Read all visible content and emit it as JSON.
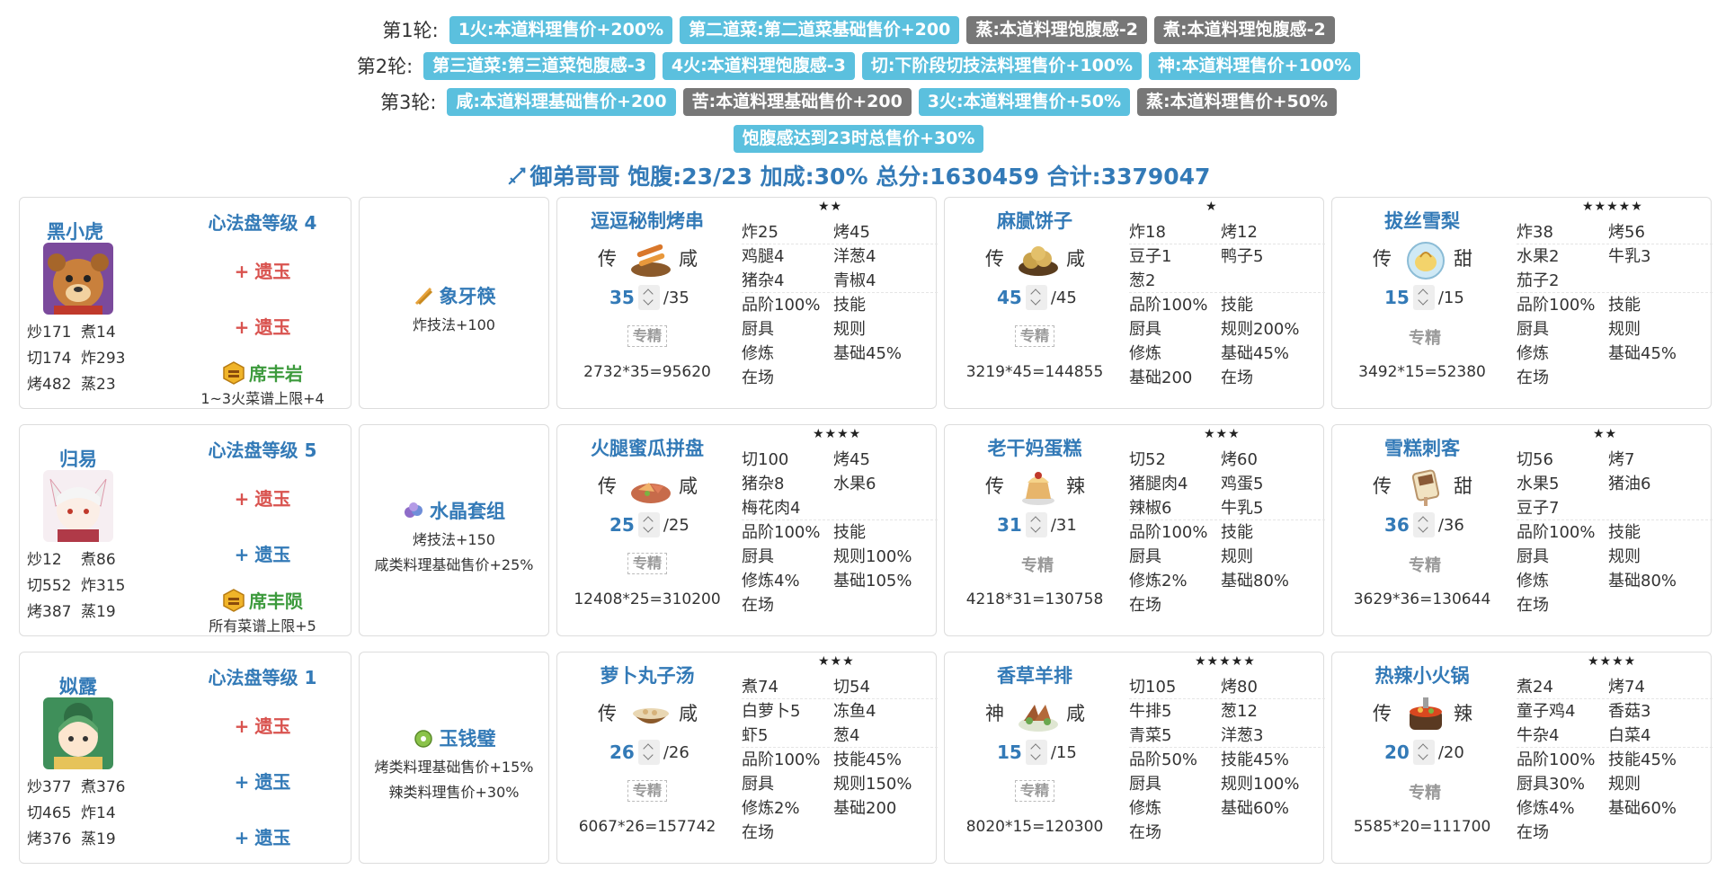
{
  "rounds": [
    {
      "label": "第1轮:",
      "tags": [
        {
          "text": "1火:本道料理售价+200%",
          "color": "blue"
        },
        {
          "text": "第二道菜:第二道菜基础售价+200",
          "color": "blue"
        },
        {
          "text": "蒸:本道料理饱腹感-2",
          "color": "gray"
        },
        {
          "text": "煮:本道料理饱腹感-2",
          "color": "gray"
        }
      ]
    },
    {
      "label": "第2轮:",
      "tags": [
        {
          "text": "第三道菜:第三道菜饱腹感-3",
          "color": "blue"
        },
        {
          "text": "4火:本道料理饱腹感-3",
          "color": "blue"
        },
        {
          "text": "切:下阶段切技法料理售价+100%",
          "color": "blue"
        },
        {
          "text": "神:本道料理售价+100%",
          "color": "blue"
        }
      ]
    },
    {
      "label": "第3轮:",
      "tags": [
        {
          "text": "咸:本道料理基础售价+200",
          "color": "blue"
        },
        {
          "text": "苦:本道料理基础售价+200",
          "color": "gray"
        },
        {
          "text": "3火:本道料理售价+50%",
          "color": "blue"
        },
        {
          "text": "蒸:本道料理售价+50%",
          "color": "gray"
        }
      ]
    },
    {
      "label": "",
      "tags": [
        {
          "text": "饱腹感达到23时总售价+30%",
          "color": "blue"
        }
      ]
    }
  ],
  "summary": {
    "text": "御弟哥哥 饱腹:23/23 加成:30% 总分:1630459 合计:3379047",
    "icon": "sword-icon"
  },
  "rows": [
    {
      "chef": {
        "name": "黑小虎",
        "avatar": "bear-avatar",
        "stats": [
          [
            "炒171",
            "煮14"
          ],
          [
            "切174",
            "炸293"
          ],
          [
            "烤482",
            "蒸23"
          ]
        ],
        "level": "心法盘等级 4",
        "ambers": [
          {
            "plus": "+",
            "name": "遗玉",
            "color": "red",
            "icon": ""
          },
          {
            "plus": "+",
            "name": "遗玉",
            "color": "red",
            "icon": ""
          },
          {
            "plus": "",
            "name": "席丰岩",
            "color": "green",
            "icon": "amber-icon"
          }
        ],
        "amber_desc": "1~3火菜谱上限+4"
      },
      "equip": {
        "name": "象牙筷",
        "icon": "chopsticks-icon",
        "effects": [
          "炸技法+100"
        ]
      },
      "recipes": [
        {
          "name": "逗逗秘制烤串",
          "origin": "传",
          "taste": "咸",
          "qty": "35",
          "max": "/35",
          "spec": "专精",
          "spec_struck": true,
          "score": "2732*35=95620",
          "stars": "★★",
          "details": [
            [
              "炸25",
              "烤45"
            ],
            [
              "鸡腿4",
              "洋葱4"
            ],
            [
              "猪杂4",
              "青椒4"
            ],
            [
              "品阶100%",
              "技能"
            ],
            [
              "厨具",
              "规则"
            ],
            [
              "修炼",
              "基础45%"
            ],
            [
              "在场",
              ""
            ]
          ]
        },
        {
          "name": "麻腻饼子",
          "origin": "传",
          "taste": "咸",
          "qty": "45",
          "max": "/45",
          "spec": "专精",
          "spec_struck": true,
          "score": "3219*45=144855",
          "stars": "★",
          "details": [
            [
              "炸18",
              "烤12"
            ],
            [
              "豆子1",
              "鸭子5"
            ],
            [
              "葱2",
              ""
            ],
            [
              "品阶100%",
              "技能"
            ],
            [
              "厨具",
              "规则200%"
            ],
            [
              "修炼",
              "基础45%"
            ],
            [
              "基础200",
              "在场"
            ]
          ]
        },
        {
          "name": "拔丝雪梨",
          "origin": "传",
          "taste": "甜",
          "qty": "15",
          "max": "/15",
          "spec": "专精",
          "spec_struck": false,
          "score": "3492*15=52380",
          "stars": "★★★★★",
          "details": [
            [
              "炸38",
              "烤56"
            ],
            [
              "水果2",
              "牛乳3"
            ],
            [
              "茄子2",
              ""
            ],
            [
              "品阶100%",
              "技能"
            ],
            [
              "厨具",
              "规则"
            ],
            [
              "修炼",
              "基础45%"
            ],
            [
              "在场",
              ""
            ]
          ]
        }
      ]
    },
    {
      "chef": {
        "name": "归易",
        "avatar": "fox-avatar",
        "stats": [
          [
            "炒12",
            "煮86"
          ],
          [
            "切552",
            "炸315"
          ],
          [
            "烤387",
            "蒸19"
          ]
        ],
        "level": "心法盘等级 5",
        "ambers": [
          {
            "plus": "+",
            "name": "遗玉",
            "color": "red",
            "icon": ""
          },
          {
            "plus": "+",
            "name": "遗玉",
            "color": "blue",
            "icon": ""
          },
          {
            "plus": "",
            "name": "席丰陨",
            "color": "green",
            "icon": "amber-icon"
          }
        ],
        "amber_desc": "所有菜谱上限+5"
      },
      "equip": {
        "name": "水晶套组",
        "icon": "crystal-icon",
        "effects": [
          "烤技法+150",
          "咸类料理基础售价+25%"
        ]
      },
      "recipes": [
        {
          "name": "火腿蜜瓜拼盘",
          "origin": "传",
          "taste": "咸",
          "qty": "25",
          "max": "/25",
          "spec": "专精",
          "spec_struck": true,
          "score": "12408*25=310200",
          "stars": "★★★★",
          "details": [
            [
              "切100",
              "烤45"
            ],
            [
              "猪杂8",
              "水果6"
            ],
            [
              "梅花肉4",
              ""
            ],
            [
              "品阶100%",
              "技能"
            ],
            [
              "厨具",
              "规则100%"
            ],
            [
              "修炼4%",
              "基础105%"
            ],
            [
              "在场",
              ""
            ]
          ]
        },
        {
          "name": "老干妈蛋糕",
          "origin": "传",
          "taste": "辣",
          "qty": "31",
          "max": "/31",
          "spec": "专精",
          "spec_struck": false,
          "score": "4218*31=130758",
          "stars": "★★★",
          "details": [
            [
              "切52",
              "烤60"
            ],
            [
              "猪腿肉4",
              "鸡蛋5"
            ],
            [
              "辣椒6",
              "牛乳5"
            ],
            [
              "品阶100%",
              "技能"
            ],
            [
              "厨具",
              "规则"
            ],
            [
              "修炼2%",
              "基础80%"
            ],
            [
              "在场",
              ""
            ]
          ]
        },
        {
          "name": "雪糕刺客",
          "origin": "传",
          "taste": "甜",
          "qty": "36",
          "max": "/36",
          "spec": "专精",
          "spec_struck": false,
          "score": "3629*36=130644",
          "stars": "★★",
          "details": [
            [
              "切56",
              "烤7"
            ],
            [
              "水果5",
              "猪油6"
            ],
            [
              "豆子7",
              ""
            ],
            [
              "品阶100%",
              "技能"
            ],
            [
              "厨具",
              "规则"
            ],
            [
              "修炼",
              "基础80%"
            ],
            [
              "在场",
              ""
            ]
          ]
        }
      ]
    },
    {
      "chef": {
        "name": "姒露",
        "avatar": "girl-avatar",
        "stats": [
          [
            "炒377",
            "煮376"
          ],
          [
            "切465",
            "炸14"
          ],
          [
            "烤376",
            "蒸19"
          ]
        ],
        "level": "心法盘等级 1",
        "ambers": [
          {
            "plus": "+",
            "name": "遗玉",
            "color": "red",
            "icon": ""
          },
          {
            "plus": "+",
            "name": "遗玉",
            "color": "blue",
            "icon": ""
          },
          {
            "plus": "+",
            "name": "遗玉",
            "color": "blue",
            "icon": ""
          }
        ],
        "amber_desc": ""
      },
      "equip": {
        "name": "玉钱璧",
        "icon": "jade-icon",
        "effects": [
          "烤类料理基础售价+15%",
          "辣类料理售价+30%"
        ]
      },
      "recipes": [
        {
          "name": "萝卜丸子汤",
          "origin": "传",
          "taste": "咸",
          "qty": "26",
          "max": "/26",
          "spec": "专精",
          "spec_struck": true,
          "score": "6067*26=157742",
          "stars": "★★★",
          "details": [
            [
              "煮74",
              "切54"
            ],
            [
              "白萝卜5",
              "冻鱼4"
            ],
            [
              "虾5",
              "葱4"
            ],
            [
              "品阶100%",
              "技能45%"
            ],
            [
              "厨具",
              "规则150%"
            ],
            [
              "修炼2%",
              "基础200"
            ],
            [
              "在场",
              ""
            ]
          ]
        },
        {
          "name": "香草羊排",
          "origin": "神",
          "taste": "咸",
          "qty": "15",
          "max": "/15",
          "spec": "专精",
          "spec_struck": true,
          "score": "8020*15=120300",
          "stars": "★★★★★",
          "details": [
            [
              "切105",
              "烤80"
            ],
            [
              "牛排5",
              "葱12"
            ],
            [
              "青菜5",
              "洋葱3"
            ],
            [
              "品阶50%",
              "技能45%"
            ],
            [
              "厨具",
              "规则100%"
            ],
            [
              "修炼",
              "基础60%"
            ],
            [
              "在场",
              ""
            ]
          ]
        },
        {
          "name": "热辣小火锅",
          "origin": "传",
          "taste": "辣",
          "qty": "20",
          "max": "/20",
          "spec": "专精",
          "spec_struck": false,
          "score": "5585*20=111700",
          "stars": "★★★★",
          "details": [
            [
              "煮24",
              "烤74"
            ],
            [
              "童子鸡4",
              "香菇3"
            ],
            [
              "牛杂4",
              "白菜4"
            ],
            [
              "品阶100%",
              "技能45%"
            ],
            [
              "厨具30%",
              "规则"
            ],
            [
              "修炼4%",
              "基础60%"
            ],
            [
              "在场",
              ""
            ]
          ]
        }
      ]
    }
  ]
}
